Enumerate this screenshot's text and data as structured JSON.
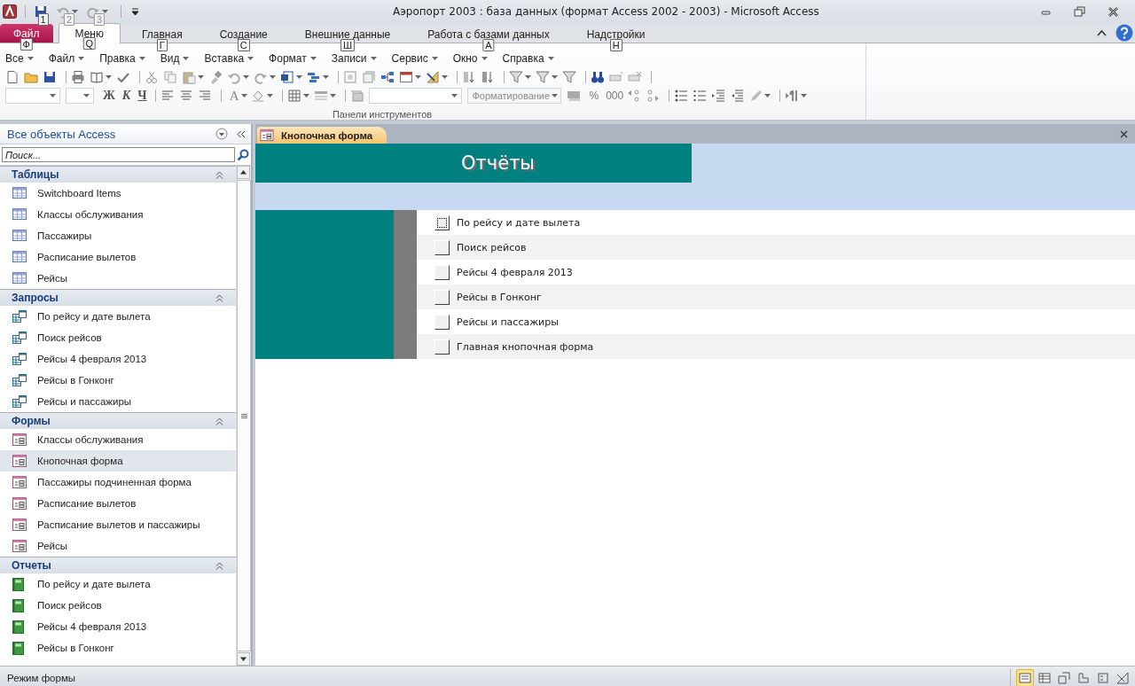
{
  "window": {
    "title": "Аэропорт 2003 : база данных (формат Access 2002 - 2003)  -  Microsoft Access",
    "quick_access_keytips": [
      "1",
      "2",
      "3"
    ]
  },
  "ribbon": {
    "tabs": [
      {
        "label": "Файл",
        "kind": "file",
        "selected": false,
        "keytip": "Ф"
      },
      {
        "label": "Меню",
        "kind": "tab",
        "selected": true,
        "keytip": "Q"
      },
      {
        "label": "Главная",
        "kind": "tab",
        "selected": false,
        "keytip": "Г"
      },
      {
        "label": "Создание",
        "kind": "tab",
        "selected": false,
        "keytip": "С"
      },
      {
        "label": "Внешние данные",
        "kind": "tab",
        "selected": false,
        "keytip": "Ш"
      },
      {
        "label": "Работа с базами данных",
        "kind": "tab",
        "selected": false,
        "keytip": "А"
      },
      {
        "label": "Надстройки",
        "kind": "tab",
        "selected": false,
        "keytip": "Н"
      }
    ],
    "menus": [
      "Все",
      "Файл",
      "Правка",
      "Вид",
      "Вставка",
      "Формат",
      "Записи",
      "Сервис",
      "Окно",
      "Справка"
    ],
    "text_buttons": [
      "Ж",
      "К",
      "Ч"
    ],
    "font_color_label": "A",
    "format_combo": "Форматирование",
    "number_buttons": [
      "%",
      "000"
    ],
    "group_label": "Панели инструментов"
  },
  "navigation": {
    "title": "Все объекты Access",
    "search": {
      "placeholder": "Поиск..."
    },
    "groups": [
      {
        "kind": "table",
        "title": "Таблицы",
        "expanded": true,
        "items": [
          {
            "label": "Switchboard Items",
            "selected": false
          },
          {
            "label": "Классы обслуживания",
            "selected": false
          },
          {
            "label": "Пассажиры",
            "selected": false
          },
          {
            "label": "Расписание вылетов",
            "selected": false
          },
          {
            "label": "Рейсы",
            "selected": false
          }
        ]
      },
      {
        "kind": "query",
        "title": "Запросы",
        "expanded": true,
        "items": [
          {
            "label": "По рейсу и дате вылета",
            "selected": false
          },
          {
            "label": "Поиск рейсов",
            "selected": false
          },
          {
            "label": "Рейсы 4 февраля 2013",
            "selected": false
          },
          {
            "label": "Рейсы в Гонконг",
            "selected": false
          },
          {
            "label": "Рейсы и пассажиры",
            "selected": false
          }
        ]
      },
      {
        "kind": "form",
        "title": "Формы",
        "expanded": true,
        "items": [
          {
            "label": "Классы обслуживания",
            "selected": false
          },
          {
            "label": "Кнопочная форма",
            "selected": true
          },
          {
            "label": "Пассажиры подчиненная форма",
            "selected": false
          },
          {
            "label": "Расписание вылетов",
            "selected": false
          },
          {
            "label": "Расписание вылетов и пассажиры",
            "selected": false
          },
          {
            "label": "Рейсы",
            "selected": false
          }
        ]
      },
      {
        "kind": "report",
        "title": "Отчеты",
        "expanded": true,
        "items": [
          {
            "label": "По рейсу и дате вылета",
            "selected": false
          },
          {
            "label": "Поиск рейсов",
            "selected": false
          },
          {
            "label": "Рейсы 4  февраля 2013",
            "selected": false
          },
          {
            "label": "Рейсы в Гонконг",
            "selected": false
          }
        ]
      }
    ]
  },
  "document_tabs": [
    {
      "label": "Кнопочная форма",
      "selected": true
    }
  ],
  "switchboard": {
    "title": "Отчёты",
    "items": [
      {
        "label": "По рейсу и дате вылета",
        "focused": true
      },
      {
        "label": "Поиск рейсов",
        "focused": false
      },
      {
        "label": "Рейсы 4  февраля 2013",
        "focused": false
      },
      {
        "label": "Рейсы в Гонконг",
        "focused": false
      },
      {
        "label": "Рейсы и пассажиры",
        "focused": false
      },
      {
        "label": "Главная кнопочная форма",
        "focused": false
      }
    ]
  },
  "status_bar": {
    "text": "Режим формы",
    "views": [
      {
        "selected": true
      },
      {
        "selected": false
      },
      {
        "selected": false
      },
      {
        "selected": false
      },
      {
        "selected": false
      },
      {
        "selected": false
      }
    ]
  }
}
